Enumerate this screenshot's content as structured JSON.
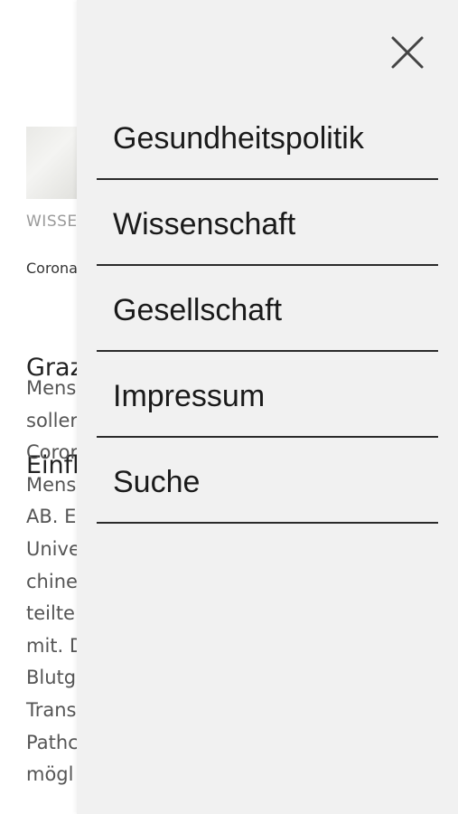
{
  "article": {
    "category": "WISSE",
    "kicker": "Corona",
    "title_lines": [
      "Graz",
      "Einfl"
    ],
    "body_lines": [
      "Mens",
      "soller",
      "Coror",
      "Mens",
      "AB. Ei",
      "Unive",
      "chine",
      "teilte",
      "mit. D",
      "Blutg",
      "Trans",
      "Pathc",
      "mögl"
    ]
  },
  "menu": {
    "close_icon": "close-icon",
    "items": [
      {
        "label": "Gesundheitspolitik"
      },
      {
        "label": "Wissenschaft"
      },
      {
        "label": "Gesellschaft"
      },
      {
        "label": "Impressum"
      },
      {
        "label": "Suche"
      }
    ]
  },
  "colors": {
    "drawer_background": "#f1f1f1",
    "divider": "#2a2a2a",
    "menu_text": "#1a1a1a"
  }
}
